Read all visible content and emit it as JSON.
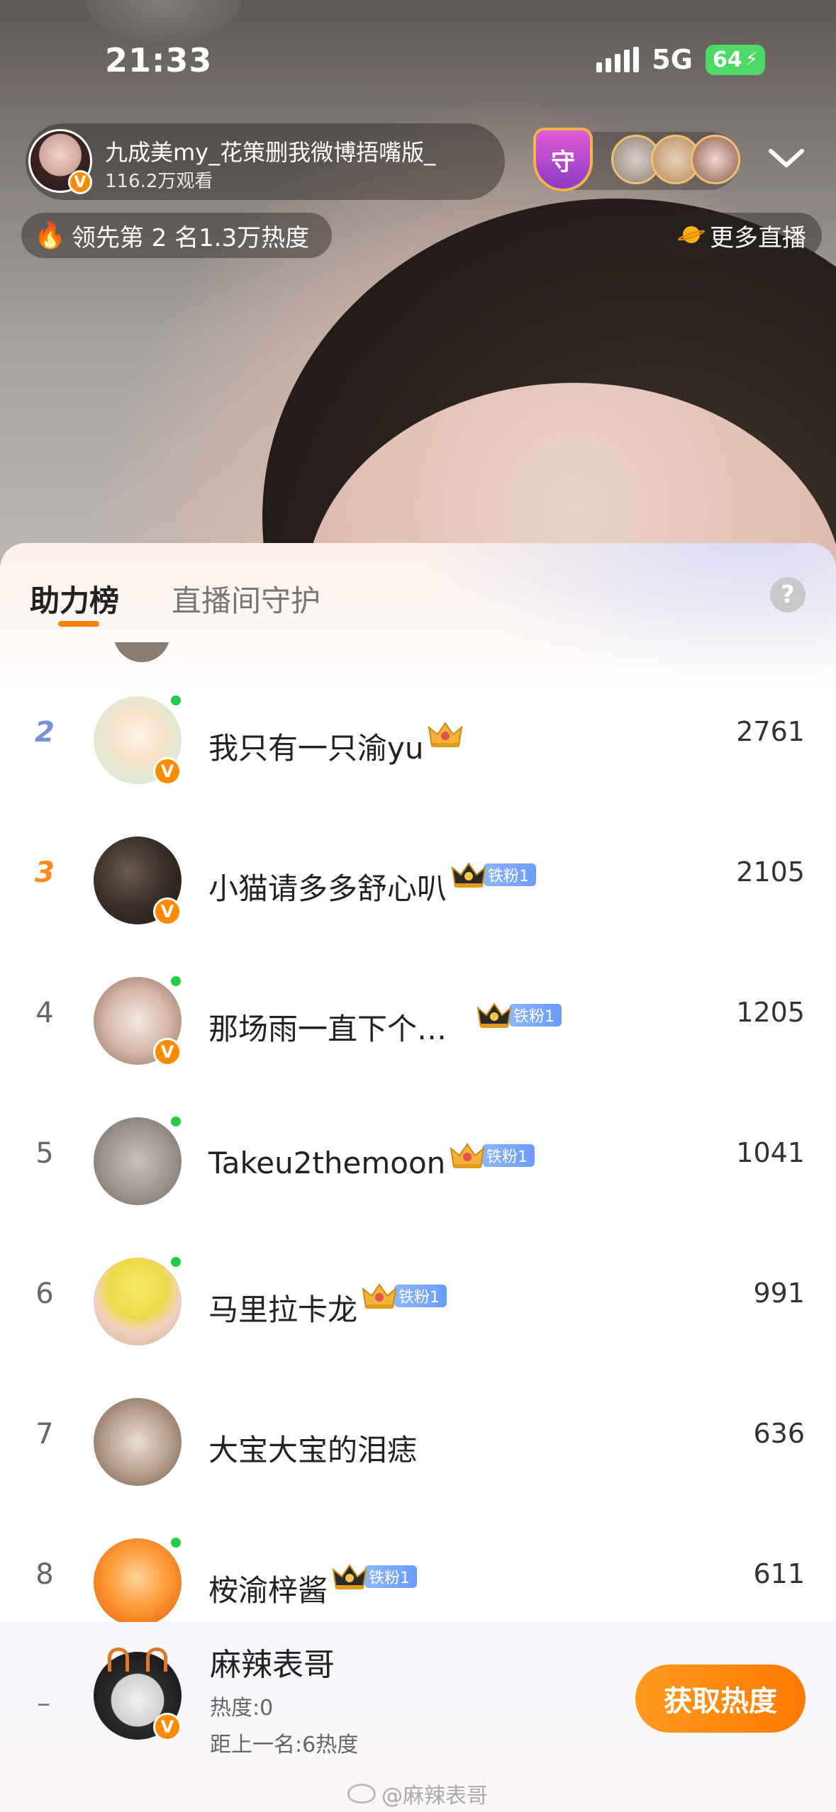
{
  "status_bar": {
    "time": "21:33",
    "network": "5G",
    "battery": "64"
  },
  "host": {
    "name": "九成美my_花策删我微博捂嘴版_",
    "viewers": "116.2万观看"
  },
  "guard_badge": "守",
  "rank_info": "领先第 2 名1.3万热度",
  "more_live": "更多直播",
  "tabs": {
    "active": "助力榜",
    "inactive": "直播间守护"
  },
  "help": "?",
  "leaderboard": [
    {
      "rank": "2",
      "name": "我只有一只渝yu",
      "score": "2761",
      "online": true,
      "fan": ""
    },
    {
      "rank": "3",
      "name": "小猫请多多舒心叭",
      "score": "2105",
      "online": false,
      "fan": "铁粉1"
    },
    {
      "rank": "4",
      "name": "那场雨一直下个…",
      "score": "1205",
      "online": true,
      "fan": "铁粉1"
    },
    {
      "rank": "5",
      "name": "Takeu2themoon",
      "score": "1041",
      "online": true,
      "fan": "铁粉1"
    },
    {
      "rank": "6",
      "name": "马里拉卡龙",
      "score": "991",
      "online": true,
      "fan": "铁粉1"
    },
    {
      "rank": "7",
      "name": "大宝大宝的泪痣",
      "score": "636",
      "online": false,
      "fan": ""
    },
    {
      "rank": "8",
      "name": "桉渝梓酱",
      "score": "611",
      "online": true,
      "fan": "铁粉1"
    }
  ],
  "me": {
    "rank": "–",
    "name": "麻辣表哥",
    "heat": "热度:0",
    "gap": "距上一名:6热度",
    "button": "获取热度"
  },
  "watermark": "@麻辣表哥",
  "colors": {
    "accent": "#ff7f00",
    "online": "#22cc44",
    "fan_badge": "#6b9bff",
    "rank2": "#7b8fd6",
    "rank3": "#ff8c1a"
  }
}
